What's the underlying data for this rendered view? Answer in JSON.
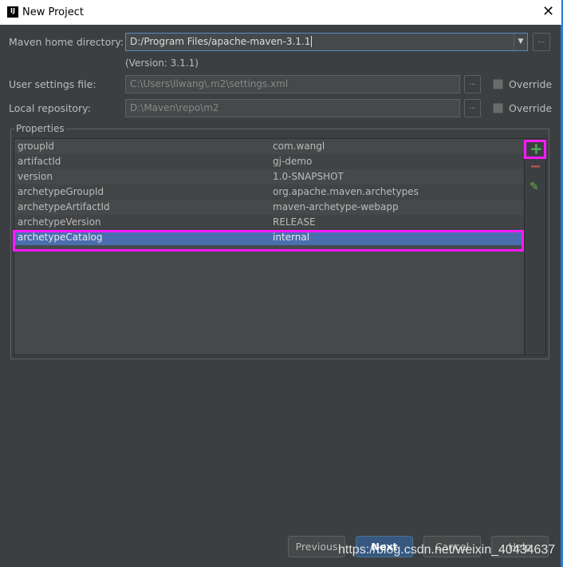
{
  "window": {
    "title": "New Project",
    "logo": "IJ"
  },
  "form": {
    "maven_home": {
      "label": "Maven home directory:",
      "value": "D:/Program Files/apache-maven-3.1.1",
      "version": "(Version: 3.1.1)"
    },
    "user_settings": {
      "label": "User settings file:",
      "value": "C:\\Users\\llwang\\.m2\\settings.xml",
      "override": "Override",
      "override_checked": false
    },
    "local_repo": {
      "label": "Local repository:",
      "value": "D:\\Maven\\repo\\m2",
      "override": "Override",
      "override_checked": false
    },
    "browse": "..."
  },
  "properties": {
    "title": "Properties",
    "rows": [
      {
        "key": "groupId",
        "value": "com.wangl"
      },
      {
        "key": "artifactId",
        "value": "gj-demo"
      },
      {
        "key": "version",
        "value": "1.0-SNAPSHOT"
      },
      {
        "key": "archetypeGroupId",
        "value": "org.apache.maven.archetypes"
      },
      {
        "key": "archetypeArtifactId",
        "value": "maven-archetype-webapp"
      },
      {
        "key": "archetypeVersion",
        "value": "RELEASE"
      },
      {
        "key": "archetypeCatalog",
        "value": "internal"
      }
    ],
    "selected_index": 6,
    "toolbar": {
      "add": "+",
      "remove": "−",
      "edit": "✎"
    }
  },
  "buttons": {
    "previous": "Previous",
    "next": "Next",
    "cancel": "Cancel",
    "help": "Help"
  },
  "watermark": "https://blog.csdn.net/weixin_40434637",
  "colors": {
    "selection": "#4b6eaf",
    "highlight": "#ff1aff",
    "add": "#4caf50",
    "remove": "#c75450"
  }
}
